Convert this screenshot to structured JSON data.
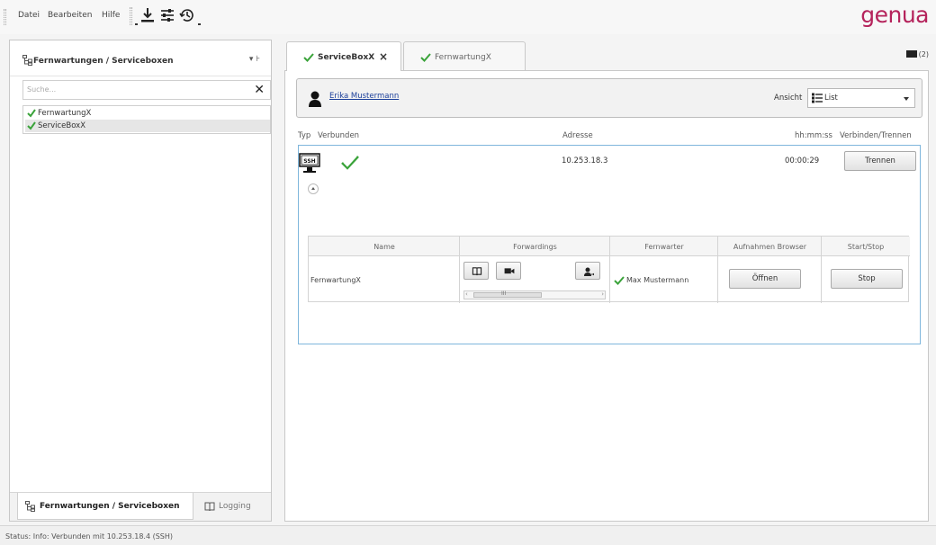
{
  "menubar": {
    "items": [
      "Datei",
      "Bearbeiten",
      "Hilfe"
    ],
    "logo": "genua",
    "toolbar_icons": [
      "download-icon",
      "settings-sliders-icon",
      "history-icon"
    ]
  },
  "left_panel": {
    "title": "Fernwartungen / Serviceboxen",
    "tools": "▾ ⊦",
    "search_placeholder": "Suche...",
    "tree": [
      {
        "label": "FernwartungX",
        "selected": false
      },
      {
        "label": "ServiceBoxX",
        "selected": true
      }
    ],
    "tabs": [
      "Fernwartungen / Serviceboxen",
      "Logging"
    ]
  },
  "right_panel": {
    "tabs": [
      {
        "label": "ServiceBoxX",
        "active": true,
        "close": "×"
      },
      {
        "label": "FernwartungX",
        "active": false
      }
    ],
    "folder_count": "(2)",
    "user": "Erika Mustermann",
    "view_label": "Ansicht",
    "view_value": "List",
    "grid_headers": {
      "typ": "Typ",
      "verbunden": "Verbunden",
      "adresse": "Adresse",
      "time": "hh:mm:ss",
      "action": "Verbinden/Trennen"
    },
    "row": {
      "type_badge": "SSH",
      "address": "10.253.18.3",
      "time": "00:00:29",
      "button": "Trennen"
    },
    "inner_table": {
      "headers": [
        "Name",
        "Forwardings",
        "Fernwarter",
        "Aufnahmen Browser",
        "Start/Stop"
      ],
      "row": {
        "name": "FernwartungX",
        "scroll_mark": "III",
        "fernwarter": "Max Mustermann",
        "open_button": "Öffnen",
        "stop_button": "Stop"
      }
    }
  },
  "status": "Status: Info: Verbunden mit 10.253.18.4 (SSH)",
  "colors": {
    "brand": "#b5245c",
    "check": "#3aa33a",
    "selection_border": "#7fb6dc",
    "link": "#1a3e9a"
  }
}
